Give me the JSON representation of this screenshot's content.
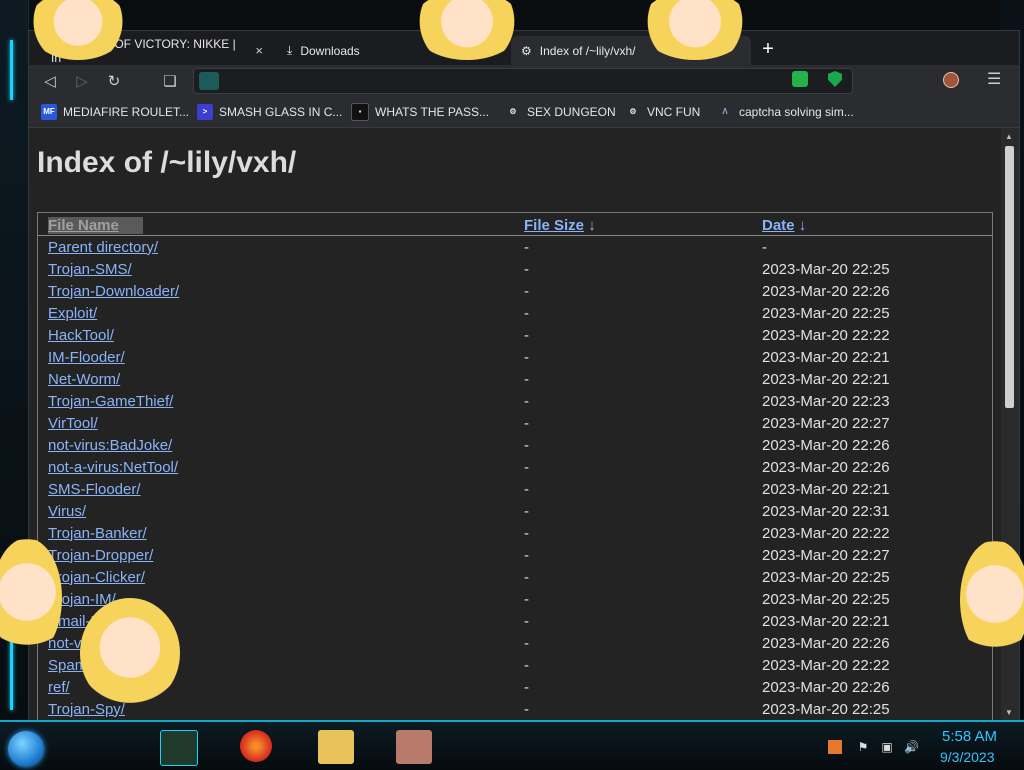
{
  "tabs": [
    {
      "label": "GODDESS OF VICTORY: NIKKE | In",
      "close": "×"
    },
    {
      "label": "Downloads"
    },
    {
      "label": "Index of /~lily/vxh/"
    }
  ],
  "newtab": "+",
  "toolbar": {
    "url": ""
  },
  "bookmarks": [
    {
      "label": "MEDIAFIRE ROULET...",
      "icon": "MF"
    },
    {
      "label": "SMASH GLASS IN C..."
    },
    {
      "label": "WHATS THE PASS..."
    },
    {
      "label": "SEX DUNGEON"
    },
    {
      "label": "VNC FUN"
    },
    {
      "label": "captcha solving sim..."
    }
  ],
  "page": {
    "title": "Index of /~lily/vxh/",
    "columns": {
      "name": "File Name",
      "size": "File Size",
      "date": "Date",
      "sort_arrow": "↓"
    },
    "rows": [
      {
        "name": "Parent directory/",
        "size": "-",
        "date": "-"
      },
      {
        "name": "Trojan-SMS/",
        "size": "-",
        "date": "2023-Mar-20 22:25"
      },
      {
        "name": "Trojan-Downloader/",
        "size": "-",
        "date": "2023-Mar-20 22:26"
      },
      {
        "name": "Exploit/",
        "size": "-",
        "date": "2023-Mar-20 22:25"
      },
      {
        "name": "HackTool/",
        "size": "-",
        "date": "2023-Mar-20 22:22"
      },
      {
        "name": "IM-Flooder/",
        "size": "-",
        "date": "2023-Mar-20 22:21"
      },
      {
        "name": "Net-Worm/",
        "size": "-",
        "date": "2023-Mar-20 22:21"
      },
      {
        "name": "Trojan-GameThief/",
        "size": "-",
        "date": "2023-Mar-20 22:23"
      },
      {
        "name": "VirTool/",
        "size": "-",
        "date": "2023-Mar-20 22:27"
      },
      {
        "name": "not-virus:BadJoke/",
        "size": "-",
        "date": "2023-Mar-20 22:26"
      },
      {
        "name": "not-a-virus:NetTool/",
        "size": "-",
        "date": "2023-Mar-20 22:26"
      },
      {
        "name": "SMS-Flooder/",
        "size": "-",
        "date": "2023-Mar-20 22:21"
      },
      {
        "name": "Virus/",
        "size": "-",
        "date": "2023-Mar-20 22:31"
      },
      {
        "name": "Trojan-Banker/",
        "size": "-",
        "date": "2023-Mar-20 22:22"
      },
      {
        "name": "Trojan-Dropper/",
        "size": "-",
        "date": "2023-Mar-20 22:27"
      },
      {
        "name": "Trojan-Clicker/",
        "size": "-",
        "date": "2023-Mar-20 22:25"
      },
      {
        "name": "Trojan-IM/",
        "size": "-",
        "date": "2023-Mar-20 22:25"
      },
      {
        "name": "Email-Flooder/",
        "size": "-",
        "date": "2023-Mar-20 22:21"
      },
      {
        "name": "not-virus:Hoax/",
        "size": "-",
        "date": "2023-Mar-20 22:26"
      },
      {
        "name": "SpamTool/",
        "size": "-",
        "date": "2023-Mar-20 22:22"
      },
      {
        "name": "ref/",
        "size": "-",
        "date": "2023-Mar-20 22:26"
      },
      {
        "name": "Trojan-Spy/",
        "size": "-",
        "date": "2023-Mar-20 22:25"
      }
    ]
  },
  "taskbar": {
    "time": "5:58 AM",
    "date": "9/3/2023"
  },
  "colors": {
    "link": "#8ab4f8",
    "accent": "#19d3ff",
    "clock": "#30c4ff"
  }
}
